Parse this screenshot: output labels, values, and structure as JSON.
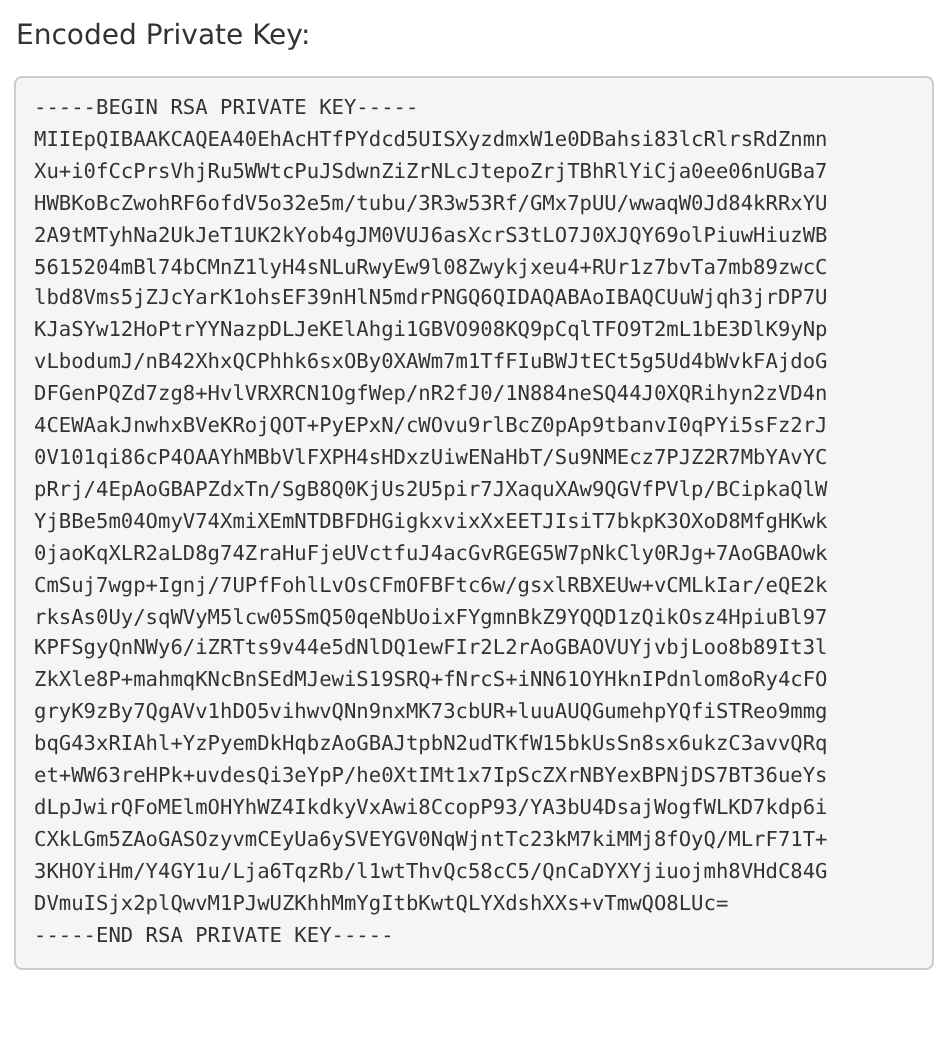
{
  "label": "Encoded Private Key:",
  "key_lines": [
    "-----BEGIN RSA PRIVATE KEY-----",
    "MIIEpQIBAAKCAQEA40EhAcHTfPYdcd5UISXyzdmxW1e0DBahsi83lcRlrsRdZnmn",
    "Xu+i0fCcPrsVhjRu5WWtcPuJSdwnZiZrNLcJtepoZrjTBhRlYiCja0ee06nUGBa7",
    "HWBKoBcZwohRF6ofdV5o32e5m/tubu/3R3w53Rf/GMx7pUU/wwaqW0Jd84kRRxYU",
    "2A9tMTyhNa2UkJeT1UK2kYob4gJM0VUJ6asXcrS3tLO7J0XJQY69olPiuwHiuzWB",
    "5615204mBl74bCMnZ1lyH4sNLuRwyEw9l08Zwykjxeu4+RUr1z7bvTa7mb89zwcC",
    "lbd8Vms5jZJcYarK1ohsEF39nHlN5mdrPNGQ6QIDAQABAoIBAQCUuWjqh3jrDP7U",
    "KJaSYw12HoPtrYYNazpDLJeKElAhgi1GBVO908KQ9pCqlTFO9T2mL1bE3DlK9yNp",
    "vLbodumJ/nB42XhxQCPhhk6sxOBy0XAWm7m1TfFIuBWJtECt5g5Ud4bWvkFAjdoG",
    "DFGenPQZd7zg8+HvlVRXRCN1OgfWep/nR2fJ0/1N884neSQ44J0XQRihyn2zVD4n",
    "4CEWAakJnwhxBVeKRojQOT+PyEPxN/cWOvu9rlBcZ0pAp9tbanvI0qPYi5sFz2rJ",
    "0V101qi86cP4OAAYhMBbVlFXPH4sHDxzUiwENaHbT/Su9NMEcz7PJZ2R7MbYAvYC",
    "pRrj/4EpAoGBAPZdxTn/SgB8Q0KjUs2U5pir7JXaquXAw9QGVfPVlp/BCipkaQlW",
    "YjBBe5m04OmyV74XmiXEmNTDBFDHGigkxvixXxEETJIsiT7bkpK3OXoD8MfgHKwk",
    "0jaoKqXLR2aLD8g74ZraHuFjeUVctfuJ4acGvRGEG5W7pNkCly0RJg+7AoGBAOwk",
    "CmSuj7wgp+Ignj/7UPfFohlLvOsCFmOFBFtc6w/gsxlRBXEUw+vCMLkIar/eQE2k",
    "rksAs0Uy/sqWVyM5lcw05SmQ50qeNbUoixFYgmnBkZ9YQQD1zQikOsz4HpiuBl97",
    "KPFSgyQnNWy6/iZRTts9v44e5dNlDQ1ewFIr2L2rAoGBAOVUYjvbjLoo8b89It3l",
    "ZkXle8P+mahmqKNcBnSEdMJewiS19SRQ+fNrcS+iNN61OYHknIPdnlom8oRy4cFO",
    "gryK9zBy7QgAVv1hDO5vihwvQNn9nxMK73cbUR+luuAUQGumehpYQfiSTReo9mmg",
    "bqG43xRIAhl+YzPyemDkHqbzAoGBAJtpbN2udTKfW15bkUsSn8sx6ukzC3avvQRq",
    "et+WW63reHPk+uvdesQi3eYpP/he0XtIMt1x7IpScZXrNBYexBPNjDS7BT36ueYs",
    "dLpJwirQFoMElmOHYhWZ4IkdkyVxAwi8CcopP93/YA3bU4DsajWogfWLKD7kdp6i",
    "CXkLGm5ZAoGASOzyvmCEyUa6ySVEYGV0NqWjntTc23kM7kiMMj8fOyQ/MLrF71T+",
    "3KHOYiHm/Y4GY1u/Lja6TqzRb/l1wtThvQc58cC5/QnCaDYXYjiuojmh8VHdC84G",
    "DVmuISjx2plQwvM1PJwUZKhhMmYgItbKwtQLYXdshXXs+vTmwQO8LUc=",
    "-----END RSA PRIVATE KEY-----"
  ]
}
